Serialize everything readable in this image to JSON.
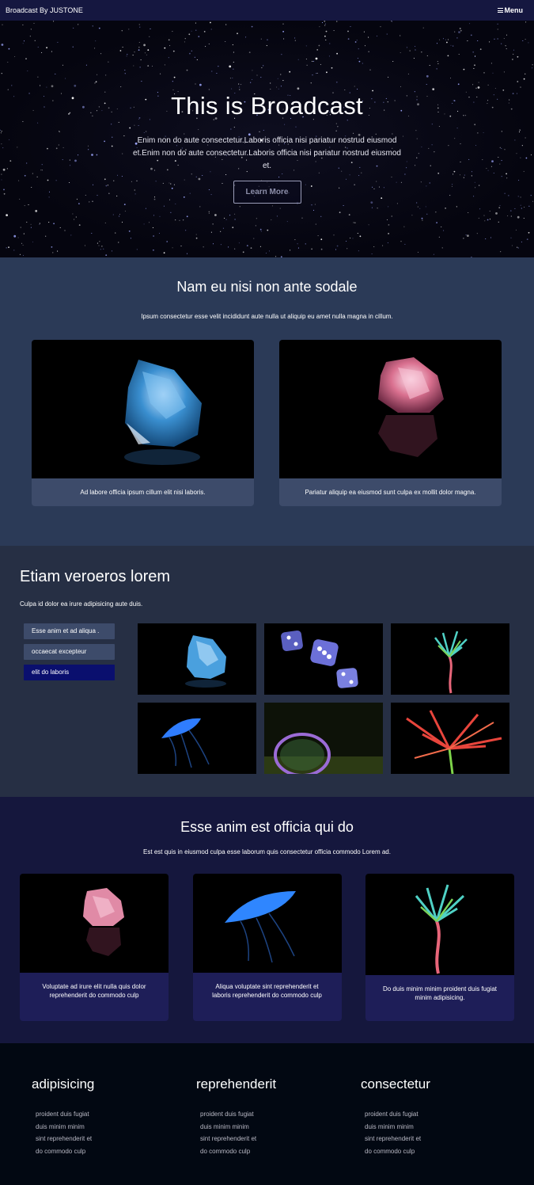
{
  "nav": {
    "brand": "Broadcast By JUSTONE",
    "menu_label": "Menu"
  },
  "hero": {
    "title": "This is Broadcast",
    "text": "Enim non do aute consectetur.Laboris officia nisi pariatur nostrud eiusmod et.Enim non do aute consectetur.Laboris officia nisi pariatur nostrud eiusmod et.",
    "button_label": "Learn More"
  },
  "section1": {
    "title": "Nam eu nisi non ante sodale",
    "subtitle": "Ipsum consectetur esse velit incididunt aute nulla ut aliquip eu amet nulla magna in cillum.",
    "cards": [
      {
        "image": "blue-crystal",
        "caption": "Ad labore officia ipsum cillum elit nisi laboris."
      },
      {
        "image": "pink-crystal",
        "caption": "Pariatur aliquip ea eiusmod sunt culpa ex mollit dolor magna."
      }
    ]
  },
  "section2": {
    "title": "Etiam veroeros lorem",
    "subtitle": "Culpa id dolor ea irure adipisicing aute duis.",
    "filters": [
      {
        "label": "Esse anim et ad aliqua ."
      },
      {
        "label": "occaecat excepteur"
      },
      {
        "label": "elit do laboris"
      }
    ],
    "active_filter": "elit do laboris",
    "gallery": [
      "blue-crystal",
      "dice",
      "glowing-flower",
      "jellyfish",
      "bubble",
      "red-lily"
    ]
  },
  "section3": {
    "title": "Esse anim est officia qui do",
    "subtitle": "Est est quis in eiusmod culpa esse laborum quis consectetur officia commodo Lorem ad.",
    "cards": [
      {
        "image": "pink-crystal",
        "caption": "Voluptate ad irure elit nulla quis dolor reprehenderit do commodo culp"
      },
      {
        "image": "jellyfish",
        "caption": "Aliqua voluptate sint reprehenderit et laboris reprehenderit do commodo culp"
      },
      {
        "image": "glowing-flower",
        "caption": "Do duis minim minim proident duis fugiat minim adipisicing."
      }
    ]
  },
  "footer": {
    "columns": [
      {
        "title": "adipisicing",
        "items": [
          "proident duis fugiat",
          "duis minim minim",
          "sint reprehenderit et",
          "do commodo culp"
        ]
      },
      {
        "title": "reprehenderit",
        "items": [
          "proident duis fugiat",
          "duis minim minim",
          "sint reprehenderit et",
          "do commodo culp"
        ]
      },
      {
        "title": "consectetur",
        "items": [
          "proident duis fugiat",
          "duis minim minim",
          "sint reprehenderit et",
          "do commodo culp"
        ]
      }
    ]
  },
  "colors": {
    "nav": "#151740",
    "section1": "#2b3a57",
    "section2": "#262f44",
    "section3": "#15173d",
    "footer": "#020812",
    "active_filter": "#0a0f6e"
  }
}
